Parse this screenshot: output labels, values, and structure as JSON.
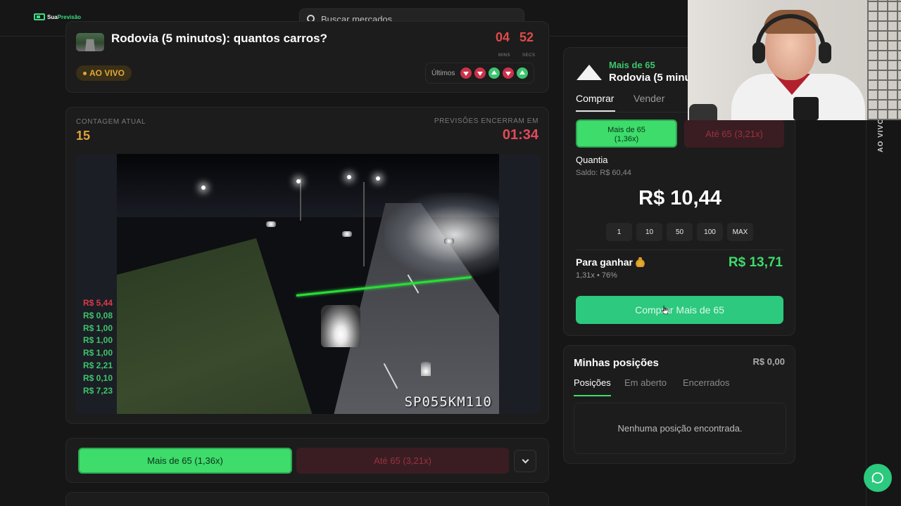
{
  "brand": {
    "name_prefix": "Sua",
    "name_suffix": "Previsão"
  },
  "search": {
    "placeholder": "Buscar mercados..."
  },
  "market": {
    "title": "Rodovia (5 minutos): quantos carros?",
    "mini_timer": {
      "minutes": "04",
      "seconds": "52",
      "mins_label": "MINS",
      "secs_label": "SECS"
    },
    "live_label": "AO VIVO",
    "ultimos_label": "Últimos",
    "recent_results": [
      "down",
      "down",
      "up",
      "down",
      "up"
    ]
  },
  "stream": {
    "count_label": "CONTAGEM ATUAL",
    "count_value": "15",
    "timer_label": "PREVISÕES ENCERRAM EM",
    "timer_value": "01:34",
    "camera_id": "SP055KM110",
    "recent_bets": [
      {
        "text": "R$ 5,44",
        "color": "red"
      },
      {
        "text": "R$ 0,08",
        "color": "green"
      },
      {
        "text": "R$ 1,00",
        "color": "green"
      },
      {
        "text": "R$ 1,00",
        "color": "green"
      },
      {
        "text": "R$ 1,00",
        "color": "green"
      },
      {
        "text": "R$ 2,21",
        "color": "green"
      },
      {
        "text": "R$ 0,10",
        "color": "green"
      },
      {
        "text": "R$ 7,23",
        "color": "green"
      }
    ]
  },
  "actions": {
    "more_label": "Mais de 65  (1,36x)",
    "less_label": "Até 65  (3,21x)"
  },
  "trade": {
    "subtitle": "Mais de 65",
    "title": "Rodovia (5 minutos): quantos carros?",
    "tabs": {
      "buy": "Comprar",
      "sell": "Vender"
    },
    "option_more": {
      "label": "Mais de 65",
      "odds": "(1,36x)"
    },
    "option_less": "Até 65  (3,21x)",
    "quantity_label": "Quantia",
    "balance": "Saldo: R$ 60,44",
    "amount": "R$ 10,44",
    "chips": [
      "1",
      "10",
      "50",
      "100",
      "MAX"
    ],
    "gain_label": "Para ganhar",
    "gain_value": "R$ 13,71",
    "gain_sub": "1,31x • 76%",
    "buy_button": "Comprar Mais de 65"
  },
  "positions": {
    "title": "Minhas posições",
    "total": "R$ 0,00",
    "tabs": [
      "Posições",
      "Em aberto",
      "Encerrados"
    ],
    "empty": "Nenhuma posição encontrada."
  },
  "side": {
    "live_label": "AO VIVO"
  },
  "colors": {
    "accent": "#3ddc6b",
    "danger": "#e04a5a",
    "warning": "#e0a23a",
    "background": "#161616"
  }
}
